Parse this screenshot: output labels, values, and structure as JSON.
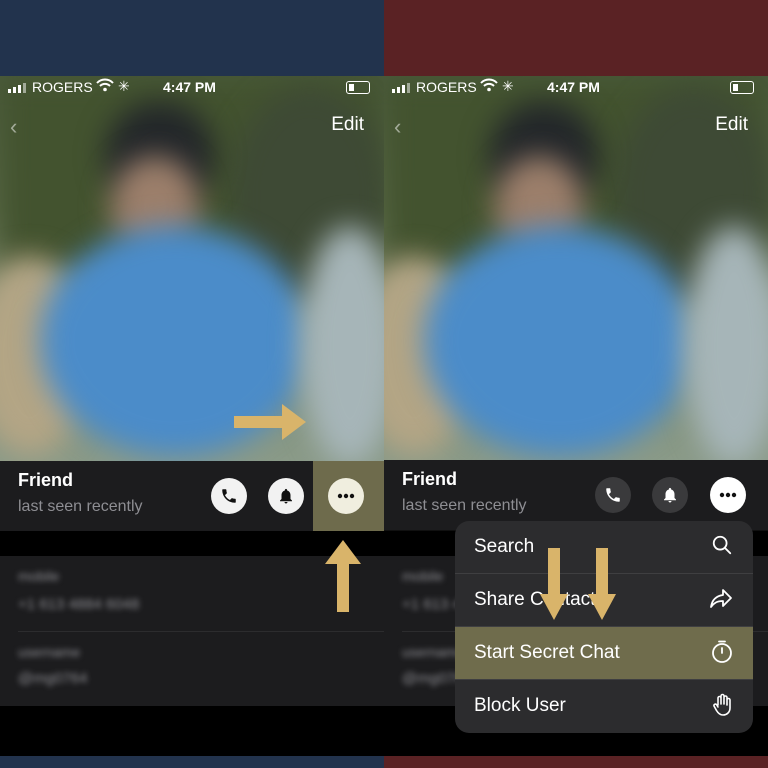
{
  "status_bar": {
    "carrier": "ROGERS",
    "time": "4:47 PM"
  },
  "header": {
    "edit_label": "Edit"
  },
  "profile": {
    "name": "Friend",
    "status": "last seen recently"
  },
  "details_blurred": {
    "row1_label": "mobile",
    "row1_value": "+1 613 4884 6048",
    "row2_label": "username",
    "row2_value": "@mg0764"
  },
  "menu": {
    "items": [
      {
        "label": "Search",
        "icon": "search-icon"
      },
      {
        "label": "Share Contact",
        "icon": "share-icon"
      },
      {
        "label": "Start Secret Chat",
        "icon": "timer-icon"
      },
      {
        "label": "Block User",
        "icon": "hand-icon"
      }
    ]
  },
  "colors": {
    "left_background": "#22334d",
    "right_background": "#5a2224",
    "highlight": "#6f6c4c",
    "arrow": "#d9b46a"
  }
}
